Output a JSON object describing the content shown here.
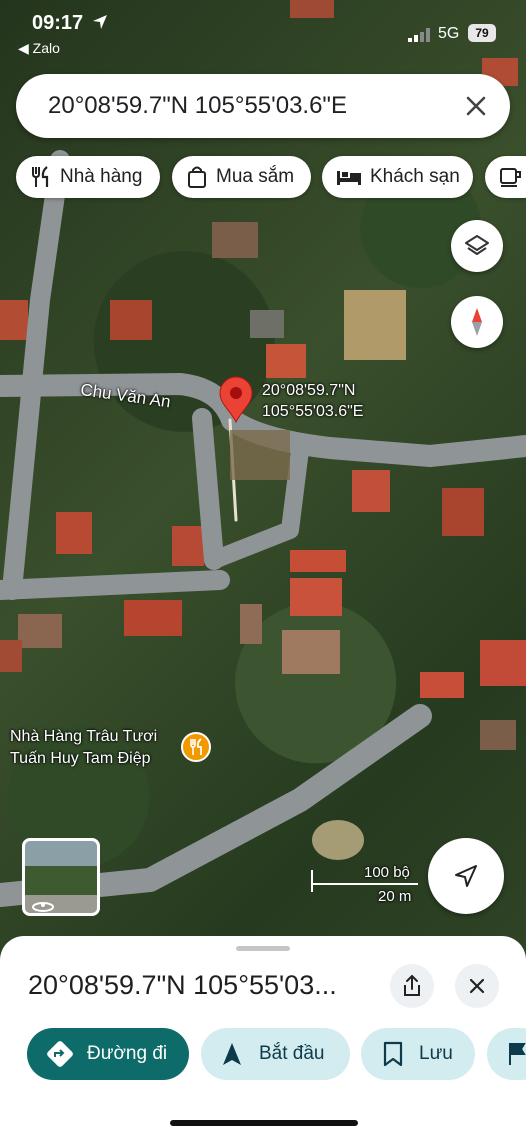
{
  "status_bar": {
    "time": "09:17",
    "back_app": "◀ Zalo",
    "network": "5G",
    "battery": "79"
  },
  "search": {
    "query": "20°08'59.7\"N 105°55'03.6\"E"
  },
  "chips": [
    {
      "label": "Nhà hàng",
      "icon": "fork-knife-icon"
    },
    {
      "label": "Mua sắm",
      "icon": "shopping-bag-icon"
    },
    {
      "label": "Khách sạn",
      "icon": "bed-icon"
    },
    {
      "label": "",
      "icon": "coffee-cup-icon"
    }
  ],
  "map": {
    "street_name": "Chu Văn An",
    "pin_label_line1": "20°08'59.7\"N",
    "pin_label_line2": "105°55'03.6\"E",
    "poi_line1": "Nhà Hàng Trâu Tươi",
    "poi_line2": "Tuấn Huy Tam Điệp",
    "scale_top": "100 bộ",
    "scale_bottom": "20 m",
    "pin_color": "#ea4335",
    "poi_color": "#f29900"
  },
  "sheet": {
    "title": "20°08'59.7\"N 105°55'03...",
    "actions": [
      {
        "label": "Đường đi",
        "icon": "directions-icon"
      },
      {
        "label": "Bắt đầu",
        "icon": "navigation-arrow-icon"
      },
      {
        "label": "Lưu",
        "icon": "bookmark-icon"
      },
      {
        "label": "",
        "icon": "flag-icon"
      }
    ],
    "primary_color": "#0b57d0",
    "accent_color": "#0d6b69"
  }
}
